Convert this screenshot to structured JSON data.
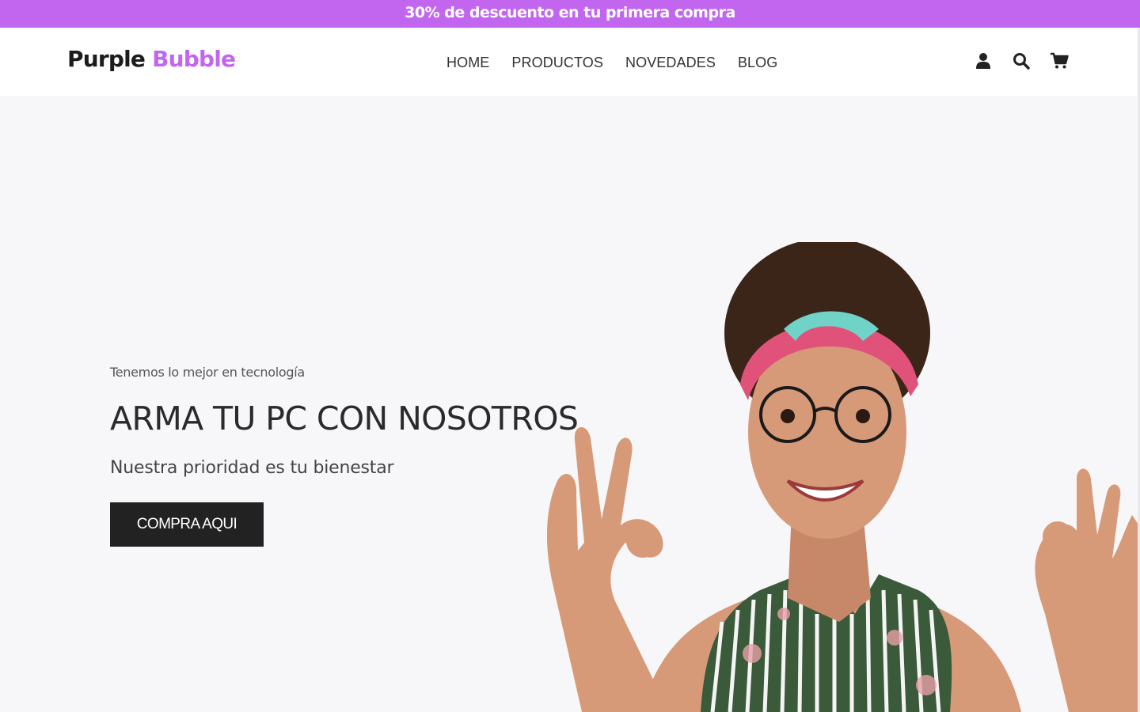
{
  "promo": {
    "text": "30% de descuento en tu primera compra"
  },
  "header": {
    "logo": {
      "part1": "Purple",
      "part2": "Bubble"
    },
    "nav": [
      {
        "label": "HOME"
      },
      {
        "label": "PRODUCTOS"
      },
      {
        "label": "NOVEDADES"
      },
      {
        "label": "BLOG"
      }
    ],
    "icons": [
      "user-icon",
      "search-icon",
      "cart-icon"
    ]
  },
  "hero": {
    "tagline": "Tenemos lo mejor en tecnología",
    "headline": "ARMA TU PC CON NOSOTROS",
    "subline": "Nuestra prioridad es tu bienestar",
    "cta_label": "COMPRA AQUI"
  },
  "colors": {
    "accent": "#c266f0",
    "cta_bg": "#222222",
    "hero_bg": "#f7f7f9"
  }
}
